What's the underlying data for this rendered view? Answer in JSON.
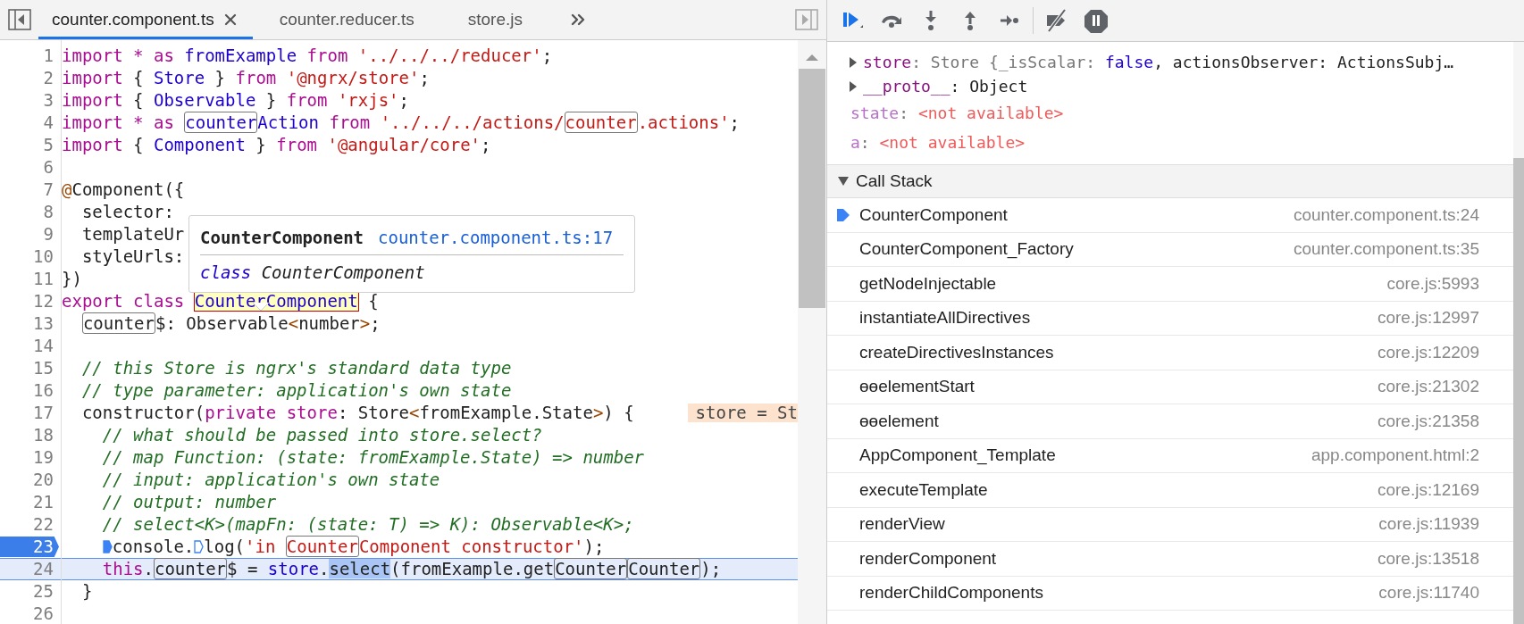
{
  "editor": {
    "tabs": [
      {
        "label": "counter.component.ts",
        "selected": true
      },
      {
        "label": "counter.reducer.ts",
        "selected": false
      },
      {
        "label": "store.js",
        "selected": false
      }
    ],
    "lines": [
      {
        "number": "1",
        "tokens": [
          {
            "text": "import * as ",
            "kind": "kw"
          },
          {
            "text": "fromExample ",
            "kind": "id"
          },
          {
            "text": "from ",
            "kind": "kw"
          },
          {
            "text": "'../../../reducer'",
            "kind": "str"
          },
          {
            "text": ";"
          }
        ]
      },
      {
        "number": "2",
        "tokens": [
          {
            "text": "import ",
            "kind": "kw"
          },
          {
            "text": "{ "
          },
          {
            "text": "Store ",
            "kind": "id"
          },
          {
            "text": "} "
          },
          {
            "text": "from ",
            "kind": "kw"
          },
          {
            "text": "'@ngrx/store'",
            "kind": "str"
          },
          {
            "text": ";"
          }
        ]
      },
      {
        "number": "3",
        "tokens": [
          {
            "text": "import ",
            "kind": "kw"
          },
          {
            "text": "{ "
          },
          {
            "text": "Observable ",
            "kind": "id"
          },
          {
            "text": "} "
          },
          {
            "text": "from ",
            "kind": "kw"
          },
          {
            "text": "'rxjs'",
            "kind": "str"
          },
          {
            "text": ";"
          }
        ]
      },
      {
        "number": "4",
        "tokens": [
          {
            "text": "import * as ",
            "kind": "kw"
          },
          {
            "text": "counter",
            "kind": "id",
            "boxed": true
          },
          {
            "text": "Action ",
            "kind": "id"
          },
          {
            "text": "from ",
            "kind": "kw"
          },
          {
            "text": "'../../../actions/",
            "kind": "str"
          },
          {
            "text": "counter",
            "kind": "str",
            "boxed": true
          },
          {
            "text": ".actions'",
            "kind": "str"
          },
          {
            "text": ";"
          }
        ]
      },
      {
        "number": "5",
        "tokens": [
          {
            "text": "import ",
            "kind": "kw"
          },
          {
            "text": "{ "
          },
          {
            "text": "Component ",
            "kind": "id"
          },
          {
            "text": "} "
          },
          {
            "text": "from ",
            "kind": "kw"
          },
          {
            "text": "'@angular/core'",
            "kind": "str"
          },
          {
            "text": ";"
          }
        ]
      },
      {
        "number": "6"
      },
      {
        "number": "7",
        "tokens": [
          {
            "text": "@",
            "kind": "deco"
          },
          {
            "text": "Component({"
          }
        ]
      },
      {
        "number": "8",
        "tokens": [
          {
            "text": "  selector:"
          }
        ]
      },
      {
        "number": "9",
        "tokens": [
          {
            "text": "  templateUr"
          }
        ]
      },
      {
        "number": "10",
        "tokens": [
          {
            "text": "  styleUrls:"
          }
        ]
      },
      {
        "number": "11",
        "tokens": [
          {
            "text": "})"
          }
        ]
      },
      {
        "number": "12",
        "tokens": [
          {
            "text": "export class ",
            "kind": "kw"
          },
          {
            "text": "CounterComponent",
            "kind": "id",
            "hovered": true
          },
          {
            "text": " {"
          }
        ]
      },
      {
        "number": "13",
        "tokens": [
          {
            "text": "  counter",
            "boxed": true
          },
          {
            "text": "$: Observable"
          },
          {
            "text": "<",
            "kind": "angle"
          },
          {
            "text": "number"
          },
          {
            "text": ">",
            "kind": "angle"
          },
          {
            "text": ";"
          }
        ]
      },
      {
        "number": "14"
      },
      {
        "number": "15",
        "tokens": [
          {
            "text": "  // this Store is ngrx's standard data type",
            "kind": "comment"
          }
        ]
      },
      {
        "number": "16",
        "tokens": [
          {
            "text": "  // type parameter: application's own state",
            "kind": "comment"
          }
        ]
      },
      {
        "number": "17",
        "tokens": [
          {
            "text": "  constructor("
          },
          {
            "text": "private store",
            "kind": "kw"
          },
          {
            "text": ": Store"
          },
          {
            "text": "<",
            "kind": "angle"
          },
          {
            "text": "fromExample.State"
          },
          {
            "text": ">",
            "kind": "angle"
          },
          {
            "text": ") {"
          }
        ],
        "inline_value": "store = St"
      },
      {
        "number": "18",
        "in_body": true,
        "tokens": [
          {
            "text": "// what should be passed into store.select?",
            "kind": "comment"
          }
        ]
      },
      {
        "number": "19",
        "in_body": true,
        "tokens": [
          {
            "text": "// map Function: (state: fromExample.State) => number",
            "kind": "comment"
          }
        ]
      },
      {
        "number": "20",
        "in_body": true,
        "tokens": [
          {
            "text": "// input: application's own state",
            "kind": "comment"
          }
        ]
      },
      {
        "number": "21",
        "in_body": true,
        "tokens": [
          {
            "text": "// output: number",
            "kind": "comment"
          }
        ]
      },
      {
        "number": "22",
        "in_body": true,
        "tokens": [
          {
            "text": "// select<K>(mapFn: (state: T) => K): Observable<K>;",
            "kind": "comment"
          }
        ]
      },
      {
        "number": "23",
        "in_body": true,
        "breakpoint": true,
        "tokens": [
          {
            "kind": "marker",
            "active": true
          },
          {
            "text": "console."
          },
          {
            "kind": "marker",
            "active": false
          },
          {
            "text": "log("
          },
          {
            "text": "'in ",
            "kind": "str"
          },
          {
            "text": "Counter",
            "kind": "str",
            "boxed": true
          },
          {
            "text": "Component constructor'",
            "kind": "str"
          },
          {
            "text": ");"
          }
        ]
      },
      {
        "number": "24",
        "in_body": true,
        "current": true,
        "tokens": [
          {
            "text": "this",
            "kind": "kw"
          },
          {
            "text": "."
          },
          {
            "text": "counter",
            "boxed": true
          },
          {
            "text": "$ = "
          },
          {
            "text": "store",
            "kind": "id"
          },
          {
            "text": "."
          },
          {
            "text": "select",
            "highlighted": true
          },
          {
            "text": "(fromExample.get"
          },
          {
            "text": "Counter",
            "boxed": true
          },
          {
            "text": "Counter",
            "boxed": true
          },
          {
            "text": ");"
          }
        ]
      },
      {
        "number": "25",
        "tokens": [
          {
            "text": "  }"
          }
        ]
      },
      {
        "number": "26"
      }
    ],
    "tooltip": {
      "name": "CounterComponent",
      "location": "counter.component.ts:17",
      "keyword": "class",
      "signature": "CounterComponent"
    }
  },
  "scope": [
    {
      "kind": "object",
      "expanded": false,
      "tokens": [
        {
          "text": "store",
          "kind": "prop"
        },
        {
          "text": ": Store {_isScalar: ",
          "kind": "dim"
        },
        {
          "text": "false",
          "kind": "id"
        },
        {
          "text": ", actionsObserver: ActionsSubj…"
        }
      ]
    },
    {
      "kind": "object",
      "expanded": false,
      "tokens": [
        {
          "text": "__proto__",
          "kind": "prop"
        },
        {
          "text": ": Object"
        }
      ]
    },
    {
      "kind": "variable",
      "tokens": [
        {
          "text": "state",
          "kind": "prop-light"
        },
        {
          "text": ":",
          "kind": "dim"
        },
        {
          "text": "<not available>",
          "kind": "unavailable"
        }
      ]
    },
    {
      "kind": "variable",
      "tokens": [
        {
          "text": "a",
          "kind": "prop-light"
        },
        {
          "text": ":",
          "kind": "dim"
        },
        {
          "text": "<not available>",
          "kind": "unavailable"
        }
      ]
    }
  ],
  "call_stack": {
    "title": "Call Stack",
    "expanded": true,
    "frames": [
      {
        "function": "CounterComponent",
        "location": "counter.component.ts:24",
        "selected": true
      },
      {
        "function": "CounterComponent_Factory",
        "location": "counter.component.ts:35",
        "selected": false
      },
      {
        "function": "getNodeInjectable",
        "location": "core.js:5993",
        "selected": false
      },
      {
        "function": "instantiateAllDirectives",
        "location": "core.js:12997",
        "selected": false
      },
      {
        "function": "createDirectivesInstances",
        "location": "core.js:12209",
        "selected": false
      },
      {
        "function": "ɵɵelementStart",
        "location": "core.js:21302",
        "selected": false
      },
      {
        "function": "ɵɵelement",
        "location": "core.js:21358",
        "selected": false
      },
      {
        "function": "AppComponent_Template",
        "location": "app.component.html:2",
        "selected": false
      },
      {
        "function": "executeTemplate",
        "location": "core.js:12169",
        "selected": false
      },
      {
        "function": "renderView",
        "location": "core.js:11939",
        "selected": false
      },
      {
        "function": "renderComponent",
        "location": "core.js:13518",
        "selected": false
      },
      {
        "function": "renderChildComponents",
        "location": "core.js:11740",
        "selected": false
      }
    ]
  }
}
